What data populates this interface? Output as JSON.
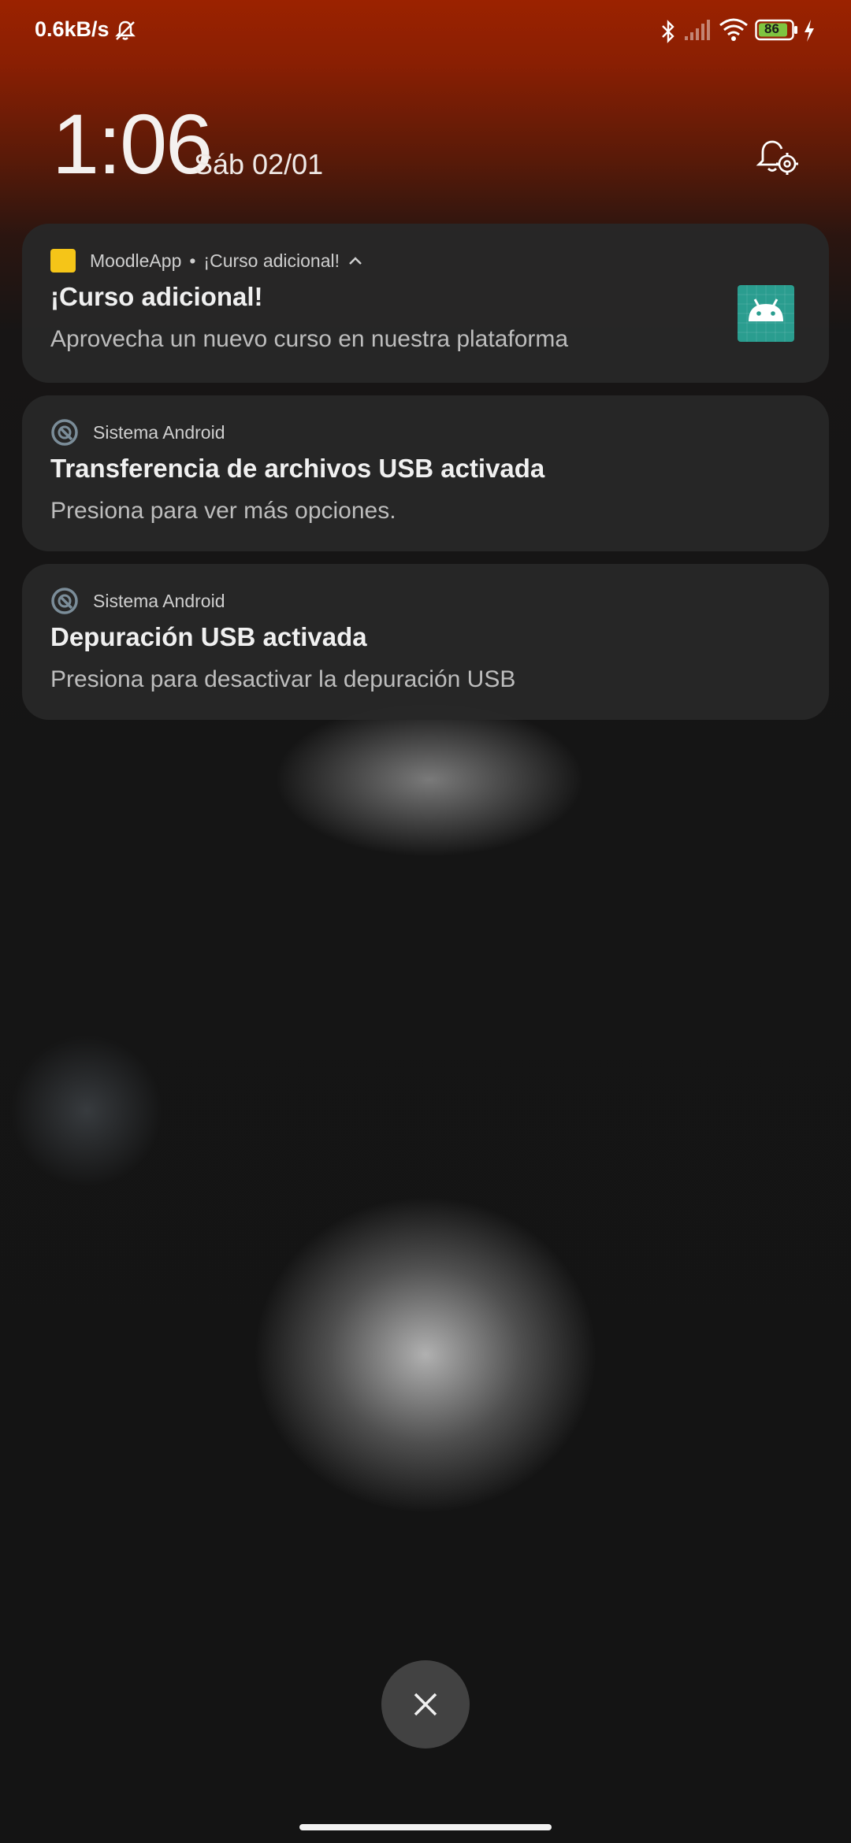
{
  "status_bar": {
    "network_speed": "0.6kB/s",
    "icons": [
      "alarm-off-icon",
      "bluetooth-icon",
      "signal-icon",
      "wifi-icon",
      "battery-icon",
      "charging-icon"
    ],
    "battery_level": "86"
  },
  "lockscreen": {
    "time": "1:06",
    "date": "Sáb 02/01"
  },
  "notifications": [
    {
      "app_name": "MoodleApp",
      "separator": "•",
      "subtext": "¡Curso adicional!",
      "title": "¡Curso adicional!",
      "body": "Aprovecha un nuevo curso en nuestra plataforma",
      "icon": "moodle-square-icon",
      "large_icon": "android-robot-icon",
      "accent": "#f5c518"
    },
    {
      "app_name": "Sistema Android",
      "title": "Transferencia de archivos USB activada",
      "body": "Presiona para ver más opciones.",
      "icon": "android-system-icon"
    },
    {
      "app_name": "Sistema Android",
      "title": "Depuración USB activada",
      "body": "Presiona para desactivar la depuración USB",
      "icon": "android-system-icon"
    }
  ],
  "colors": {
    "header_red": "#9b2200",
    "card_bg": "#282828",
    "thumb_teal": "#2a9d8f"
  }
}
